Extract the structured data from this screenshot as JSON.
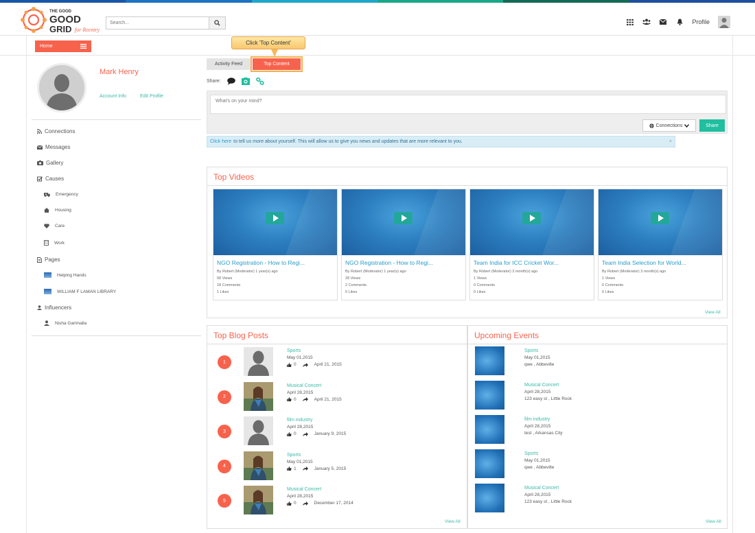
{
  "colors": {
    "accent": "#f7624c",
    "teal": "#1fbfa0",
    "link": "#2a9cc8"
  },
  "header": {
    "logo_text_line1": "THE GOOD",
    "logo_text_line2": "GRID",
    "logo_text_line3": "for Reentry",
    "search_placeholder": "Search...",
    "profile_label": "Profile"
  },
  "nav": {
    "home_label": "Home"
  },
  "callout": {
    "text": "Click 'Top Content'"
  },
  "tabs": [
    {
      "label": "Activity Feed"
    },
    {
      "label": "Top Content"
    }
  ],
  "user": {
    "name": "Mark Henry",
    "account_info": "Account Info",
    "edit_profile": "Edit Profile"
  },
  "sidebar": {
    "connections": "Connections",
    "messages": "Messages",
    "gallery": "Gallery",
    "causes": "Causes",
    "causes_items": [
      "Emergency",
      "Housing",
      "Care",
      "Work"
    ],
    "pages": "Pages",
    "pages_items": [
      "Helping Hands",
      "WILLIAM F LAMAN LIBRARY"
    ],
    "influencers": "Influencers",
    "influencers_items": [
      "Nisha Garimalla"
    ]
  },
  "share": {
    "label": "Share:",
    "placeholder": "What's on your mind?",
    "connections_btn": "Connections",
    "share_btn": "Share"
  },
  "info_bar": {
    "link": "Click here",
    "text": "to tell us more about yourself. This will allow us to give you news and updates that are more relevant to you."
  },
  "top_videos": {
    "title": "Top Videos",
    "view_all": "View All",
    "items": [
      {
        "title": "NGO Registration - How to Regi...",
        "by": "By Robert (Moderator) 1 year(s) ago",
        "views": "58 Views",
        "comments": "18 Comments",
        "likes": "1 Likes"
      },
      {
        "title": "NGO Registration - How to Regi...",
        "by": "By Robert (Moderator) 1 year(s) ago",
        "views": "28 Views",
        "comments": "2 Comments",
        "likes": "0 Likes"
      },
      {
        "title": "Team India for ICC Cricket Wor...",
        "by": "By Robert (Moderator) 3 month(s) ago",
        "views": "1 Views",
        "comments": "0 Comments",
        "likes": "0 Likes"
      },
      {
        "title": "Team India Selection for World...",
        "by": "By Robert (Moderator) 3 month(s) ago",
        "views": "1 Views",
        "comments": "0 Comments",
        "likes": "0 Likes"
      }
    ]
  },
  "top_blog_posts": {
    "title": "Top Blog Posts",
    "view_all": "View All",
    "items": [
      {
        "rank": "1",
        "title": "Sports",
        "date": "May 01,2015",
        "likes": "0",
        "shared": "April 21, 2015"
      },
      {
        "rank": "2",
        "title": "Musical Concert",
        "date": "April 28,2015",
        "likes": "0",
        "shared": "April 21, 2015"
      },
      {
        "rank": "3",
        "title": "film industry",
        "date": "April 28,2015",
        "likes": "0",
        "shared": "January 9, 2015"
      },
      {
        "rank": "4",
        "title": "Sports",
        "date": "May 01,2015",
        "likes": "1",
        "shared": "January 5, 2015"
      },
      {
        "rank": "5",
        "title": "Musical Concert",
        "date": "April 28,2015",
        "likes": "0",
        "shared": "December 17, 2014"
      }
    ]
  },
  "upcoming_events": {
    "title": "Upcoming Events",
    "view_all": "View All",
    "items": [
      {
        "title": "Sports",
        "date": "May 01,2015",
        "location": "qwe , Abbeville"
      },
      {
        "title": "Musical Concert",
        "date": "April 28,2015",
        "location": "123 easy st , Little Rock"
      },
      {
        "title": "film industry",
        "date": "April 28,2015",
        "location": "test , Arkansas City"
      },
      {
        "title": "Sports",
        "date": "May 01,2015",
        "location": "qwe , Abbeville"
      },
      {
        "title": "Musical Concert",
        "date": "April 28,2015",
        "location": "123 easy st , Little Rock"
      }
    ]
  }
}
